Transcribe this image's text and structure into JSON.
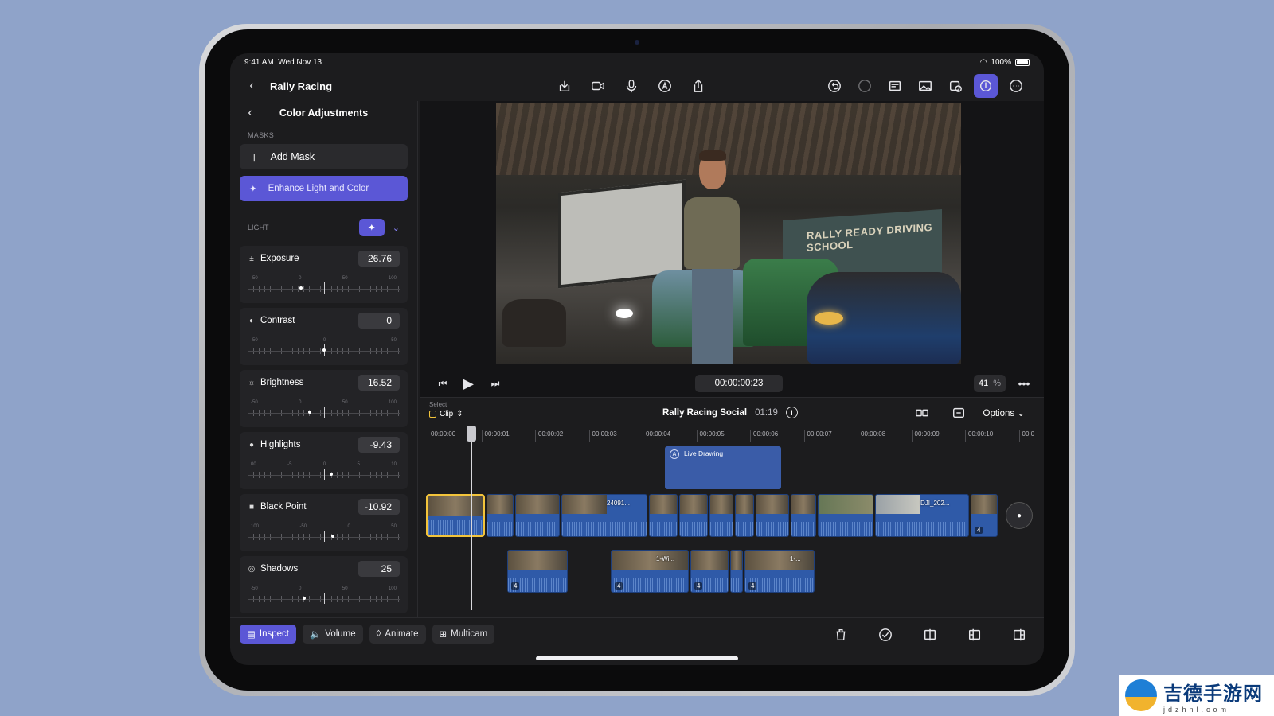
{
  "status_bar": {
    "time": "9:41 AM",
    "date": "Wed Nov 13",
    "battery": "100%"
  },
  "top_bar": {
    "title": "Rally Racing"
  },
  "inspector": {
    "title": "Color Adjustments",
    "masks_label": "MASKS",
    "add_mask": "Add Mask",
    "enhance": "Enhance Light and Color",
    "light_label": "LIGHT",
    "adjustments": [
      {
        "name": "Exposure",
        "icon": "±",
        "value": "26.76",
        "scale": [
          "-50",
          "0",
          "50",
          "100"
        ],
        "position": 0.35
      },
      {
        "name": "Contrast",
        "icon": "◐",
        "value": "0",
        "scale": [
          "-50",
          "0",
          "50"
        ],
        "position": 0.5
      },
      {
        "name": "Brightness",
        "icon": "☼",
        "value": "16.52",
        "scale": [
          "-50",
          "0",
          "50",
          "100"
        ],
        "position": 0.41
      },
      {
        "name": "Highlights",
        "icon": "●",
        "value": "-9.43",
        "scale": [
          "00",
          "-5",
          "0",
          "5",
          "10"
        ],
        "position": 0.55
      },
      {
        "name": "Black Point",
        "icon": "■",
        "value": "-10.92",
        "scale": [
          "100",
          "-50",
          "0",
          "50"
        ],
        "position": 0.56
      },
      {
        "name": "Shadows",
        "icon": "◎",
        "value": "25",
        "scale": [
          "-50",
          "0",
          "50",
          "100"
        ],
        "position": 0.37
      }
    ]
  },
  "viewer": {
    "timecode": "00:00:00:23",
    "zoom": "41",
    "zoom_unit": "%",
    "banner_text": "RALLY READY DRIVING SCHOOL"
  },
  "timeline": {
    "select_label": "Select",
    "select_value": "Clip",
    "project_name": "Rally Racing Social",
    "duration": "01:19",
    "options": "Options",
    "ruler": [
      "00:00:00",
      "00:00:01",
      "00:00:02",
      "00:00:03",
      "00:00:04",
      "00:00:05",
      "00:00:06",
      "00:00:07",
      "00:00:08",
      "00:00:09",
      "00:00:10",
      "00:0"
    ],
    "live_drawing": "Live Drawing",
    "clip_labels": [
      "24091...",
      "DJI_202...",
      "1-Wi...",
      "1-..."
    ],
    "badge": "4"
  },
  "bottom_bar": {
    "tabs": [
      "Inspect",
      "Volume",
      "Animate",
      "Multicam"
    ]
  },
  "watermark": {
    "text": "吉德手游网",
    "sub": "jdzhnl.com"
  },
  "colors": {
    "accent": "#5b57d6",
    "selection": "#f3c43b",
    "clip": "#2f5aa8"
  }
}
